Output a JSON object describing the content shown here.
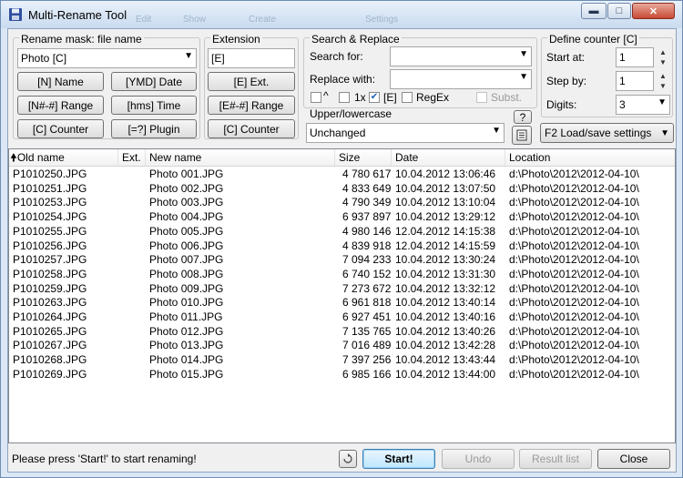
{
  "window": {
    "title": "Multi-Rename Tool",
    "ghost_menu": [
      "Edit",
      "Show",
      "Create",
      "Settings"
    ]
  },
  "mask": {
    "label": "Rename mask: file name",
    "value": "Photo [C]",
    "buttons": {
      "name": "[N]  Name",
      "date": "[YMD]  Date",
      "range": "[N#-#]  Range",
      "time": "[hms]  Time",
      "counter": "[C]  Counter",
      "plugin": "[=?]  Plugin"
    }
  },
  "extension": {
    "label": "Extension",
    "value": "[E]",
    "buttons": {
      "ext": "[E]  Ext.",
      "range": "[E#-#]  Range",
      "counter": "[C]  Counter"
    }
  },
  "search": {
    "group_label": "Search & Replace",
    "search_label": "Search for:",
    "search_value": "",
    "replace_label": "Replace with:",
    "replace_value": "",
    "opt_case_label": "^",
    "opt_once_label": "1x",
    "opt_ext_label": "[E]",
    "opt_regex_label": "RegEx",
    "opt_subst_label": "Subst."
  },
  "case": {
    "label": "Upper/lowercase",
    "value": "Unchanged",
    "help_label": "?"
  },
  "counter": {
    "label": "Define counter [C]",
    "start_label": "Start at:",
    "start_value": "1",
    "step_label": "Step by:",
    "step_value": "1",
    "digits_label": "Digits:",
    "digits_value": "3",
    "load_save_label": "F2 Load/save settings"
  },
  "table": {
    "columns": [
      "Old name",
      "Ext.",
      "New name",
      "Size",
      "Date",
      "Location"
    ],
    "rows": [
      {
        "old": "P1010250.JPG",
        "ext": "",
        "new": "Photo 001.JPG",
        "size": "4 780 617",
        "date": "10.04.2012 13:06:46",
        "loc": "d:\\Photo\\2012\\2012-04-10\\"
      },
      {
        "old": "P1010251.JPG",
        "ext": "",
        "new": "Photo 002.JPG",
        "size": "4 833 649",
        "date": "10.04.2012 13:07:50",
        "loc": "d:\\Photo\\2012\\2012-04-10\\"
      },
      {
        "old": "P1010253.JPG",
        "ext": "",
        "new": "Photo 003.JPG",
        "size": "4 790 349",
        "date": "10.04.2012 13:10:04",
        "loc": "d:\\Photo\\2012\\2012-04-10\\"
      },
      {
        "old": "P1010254.JPG",
        "ext": "",
        "new": "Photo 004.JPG",
        "size": "6 937 897",
        "date": "10.04.2012 13:29:12",
        "loc": "d:\\Photo\\2012\\2012-04-10\\"
      },
      {
        "old": "P1010255.JPG",
        "ext": "",
        "new": "Photo 005.JPG",
        "size": "4 980 146",
        "date": "12.04.2012 14:15:38",
        "loc": "d:\\Photo\\2012\\2012-04-10\\"
      },
      {
        "old": "P1010256.JPG",
        "ext": "",
        "new": "Photo 006.JPG",
        "size": "4 839 918",
        "date": "12.04.2012 14:15:59",
        "loc": "d:\\Photo\\2012\\2012-04-10\\"
      },
      {
        "old": "P1010257.JPG",
        "ext": "",
        "new": "Photo 007.JPG",
        "size": "7 094 233",
        "date": "10.04.2012 13:30:24",
        "loc": "d:\\Photo\\2012\\2012-04-10\\"
      },
      {
        "old": "P1010258.JPG",
        "ext": "",
        "new": "Photo 008.JPG",
        "size": "6 740 152",
        "date": "10.04.2012 13:31:30",
        "loc": "d:\\Photo\\2012\\2012-04-10\\"
      },
      {
        "old": "P1010259.JPG",
        "ext": "",
        "new": "Photo 009.JPG",
        "size": "7 273 672",
        "date": "10.04.2012 13:32:12",
        "loc": "d:\\Photo\\2012\\2012-04-10\\"
      },
      {
        "old": "P1010263.JPG",
        "ext": "",
        "new": "Photo 010.JPG",
        "size": "6 961 818",
        "date": "10.04.2012 13:40:14",
        "loc": "d:\\Photo\\2012\\2012-04-10\\"
      },
      {
        "old": "P1010264.JPG",
        "ext": "",
        "new": "Photo 011.JPG",
        "size": "6 927 451",
        "date": "10.04.2012 13:40:16",
        "loc": "d:\\Photo\\2012\\2012-04-10\\"
      },
      {
        "old": "P1010265.JPG",
        "ext": "",
        "new": "Photo 012.JPG",
        "size": "7 135 765",
        "date": "10.04.2012 13:40:26",
        "loc": "d:\\Photo\\2012\\2012-04-10\\"
      },
      {
        "old": "P1010267.JPG",
        "ext": "",
        "new": "Photo 013.JPG",
        "size": "7 016 489",
        "date": "10.04.2012 13:42:28",
        "loc": "d:\\Photo\\2012\\2012-04-10\\"
      },
      {
        "old": "P1010268.JPG",
        "ext": "",
        "new": "Photo 014.JPG",
        "size": "7 397 256",
        "date": "10.04.2012 13:43:44",
        "loc": "d:\\Photo\\2012\\2012-04-10\\"
      },
      {
        "old": "P1010269.JPG",
        "ext": "",
        "new": "Photo 015.JPG",
        "size": "6 985 166",
        "date": "10.04.2012 13:44:00",
        "loc": "d:\\Photo\\2012\\2012-04-10\\"
      }
    ]
  },
  "footer": {
    "status": "Please press 'Start!' to start renaming!",
    "start": "Start!",
    "undo": "Undo",
    "result_list": "Result list",
    "close": "Close"
  },
  "icons": {
    "app": "floppy-disk-icon",
    "sort": "sort-arrow-up-icon",
    "refresh": "refresh-icon",
    "edit_case": "notepad-icon"
  }
}
